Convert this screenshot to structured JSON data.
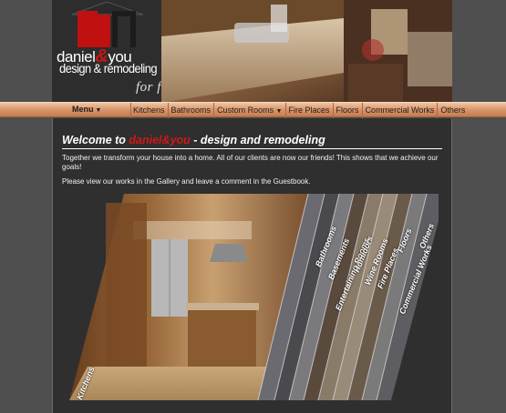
{
  "brand": {
    "name_part1": "daniel",
    "amp": "&",
    "name_part2": "you",
    "tagline": "design & remodeling",
    "slogan": "for friends"
  },
  "nav": {
    "menu_label": "Menu",
    "items": [
      {
        "label": "Kitchens"
      },
      {
        "label": "Bathrooms"
      },
      {
        "label": "Custom Rooms"
      },
      {
        "label": "Fire Places"
      },
      {
        "label": "Floors"
      },
      {
        "label": "Commercial Works"
      },
      {
        "label": "Others"
      }
    ]
  },
  "content": {
    "welcome_prefix": "Welcome to ",
    "welcome_brand1": "daniel",
    "welcome_amp": "&",
    "welcome_brand2": "you",
    "welcome_suffix": " - design and remodeling",
    "paragraph1": "Together we transform your house into a home. All of our clients are now our friends! This shows that we achieve our goals!",
    "paragraph2": "Please view our works in the Gallery and leave a comment in the Guestbook."
  },
  "gallery": {
    "categories": [
      {
        "label": "Kitchens"
      },
      {
        "label": "Bathrooms"
      },
      {
        "label": "Basements"
      },
      {
        "label": "Entertaining Rooms"
      },
      {
        "label": "Humidors"
      },
      {
        "label": "Wine Rooms"
      },
      {
        "label": "Fire Places"
      },
      {
        "label": "Floors"
      },
      {
        "label": "Commercial Works"
      },
      {
        "label": "Others"
      }
    ]
  },
  "colors": {
    "accent_red": "#d01818",
    "nav_bar": "#d9956b",
    "content_bg": "#2f2f2f",
    "page_bg": "#4f4f4f"
  }
}
